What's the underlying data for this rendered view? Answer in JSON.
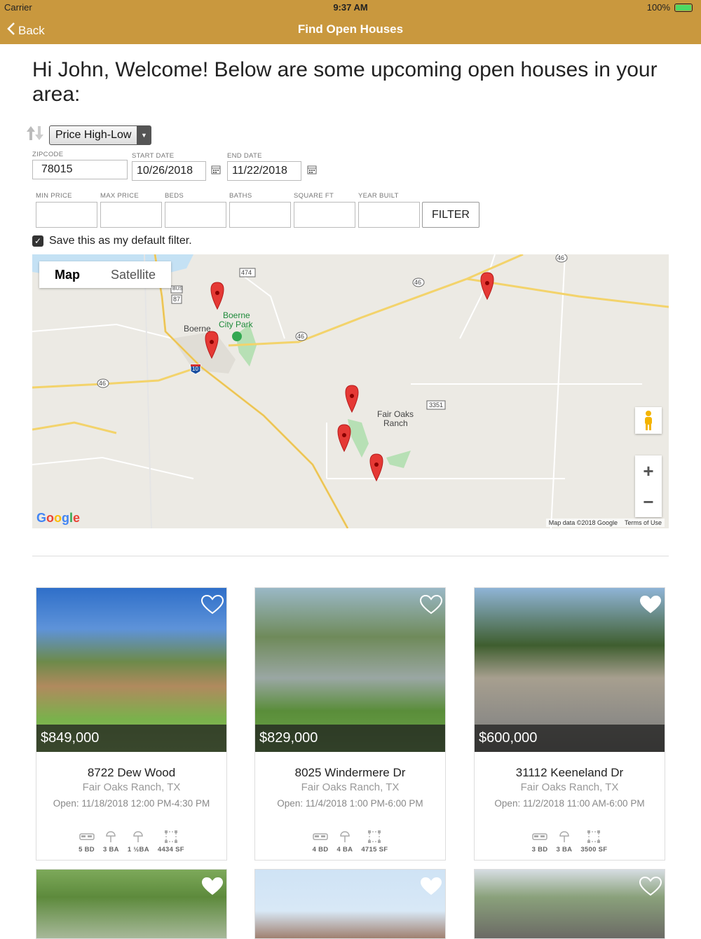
{
  "status_bar": {
    "carrier": "Carrier",
    "time": "9:37 AM",
    "battery": "100%"
  },
  "nav": {
    "back_label": "Back",
    "title": "Find Open Houses"
  },
  "welcome": "Hi John, Welcome! Below are some upcoming open houses in your area:",
  "sort": {
    "selected": "Price High-Low"
  },
  "filters": {
    "zipcode_label": "ZIPCODE",
    "zipcode": "78015",
    "start_date_label": "START DATE",
    "start_date": "10/26/2018",
    "end_date_label": "END DATE",
    "end_date": "11/22/2018",
    "min_price_label": "MIN PRICE",
    "max_price_label": "MAX PRICE",
    "beds_label": "BEDS",
    "baths_label": "BATHS",
    "square_ft_label": "SQUARE FT",
    "year_built_label": "YEAR BUILT",
    "filter_button": "FILTER",
    "save_default": "Save this as my default filter.",
    "save_default_checked": true
  },
  "map": {
    "tab_map": "Map",
    "tab_satellite": "Satellite",
    "logo": "Google",
    "attribution": "Map data ©2018 Google",
    "terms": "Terms of Use",
    "labels": {
      "boerne": "Boerne",
      "park_1": "Boerne",
      "park_2": "City Park",
      "fair_oaks_1": "Fair Oaks",
      "fair_oaks_2": "Ranch",
      "r474": "474",
      "r46a": "46",
      "r46b": "46",
      "r46c": "46",
      "r46d": "46",
      "r87": "87",
      "bus": "BUS",
      "r10": "10",
      "r3351": "3351"
    },
    "colors": {
      "pin": "#e53935",
      "park": "#8fd19e",
      "road": "#f3d36b"
    }
  },
  "listings": [
    {
      "price": "$849,000",
      "street": "8722 Dew Wood",
      "city": "Fair Oaks Ranch, TX",
      "open": "Open: 11/18/2018 12:00 PM-4:30 PM",
      "features": [
        {
          "icon": "bed-icon",
          "label": "5 BD"
        },
        {
          "icon": "shower-icon",
          "label": "3 BA"
        },
        {
          "icon": "shower-icon",
          "label": "1 ½BA"
        },
        {
          "icon": "square-footage-icon",
          "label": "4434 SF"
        }
      ],
      "favorited": false
    },
    {
      "price": "$829,000",
      "street": "8025 Windermere Dr",
      "city": "Fair Oaks Ranch, TX",
      "open": "Open: 11/4/2018 1:00 PM-6:00 PM",
      "features": [
        {
          "icon": "bed-icon",
          "label": "4 BD"
        },
        {
          "icon": "shower-icon",
          "label": "4 BA"
        },
        {
          "icon": "square-footage-icon",
          "label": "4715 SF"
        }
      ],
      "favorited": false
    },
    {
      "price": "$600,000",
      "street": "31112 Keeneland Dr",
      "city": "Fair Oaks Ranch, TX",
      "open": "Open: 11/2/2018 11:00 AM-6:00 PM",
      "features": [
        {
          "icon": "bed-icon",
          "label": "3 BD"
        },
        {
          "icon": "shower-icon",
          "label": "3 BA"
        },
        {
          "icon": "square-footage-icon",
          "label": "3500 SF"
        }
      ],
      "favorited": true
    }
  ]
}
